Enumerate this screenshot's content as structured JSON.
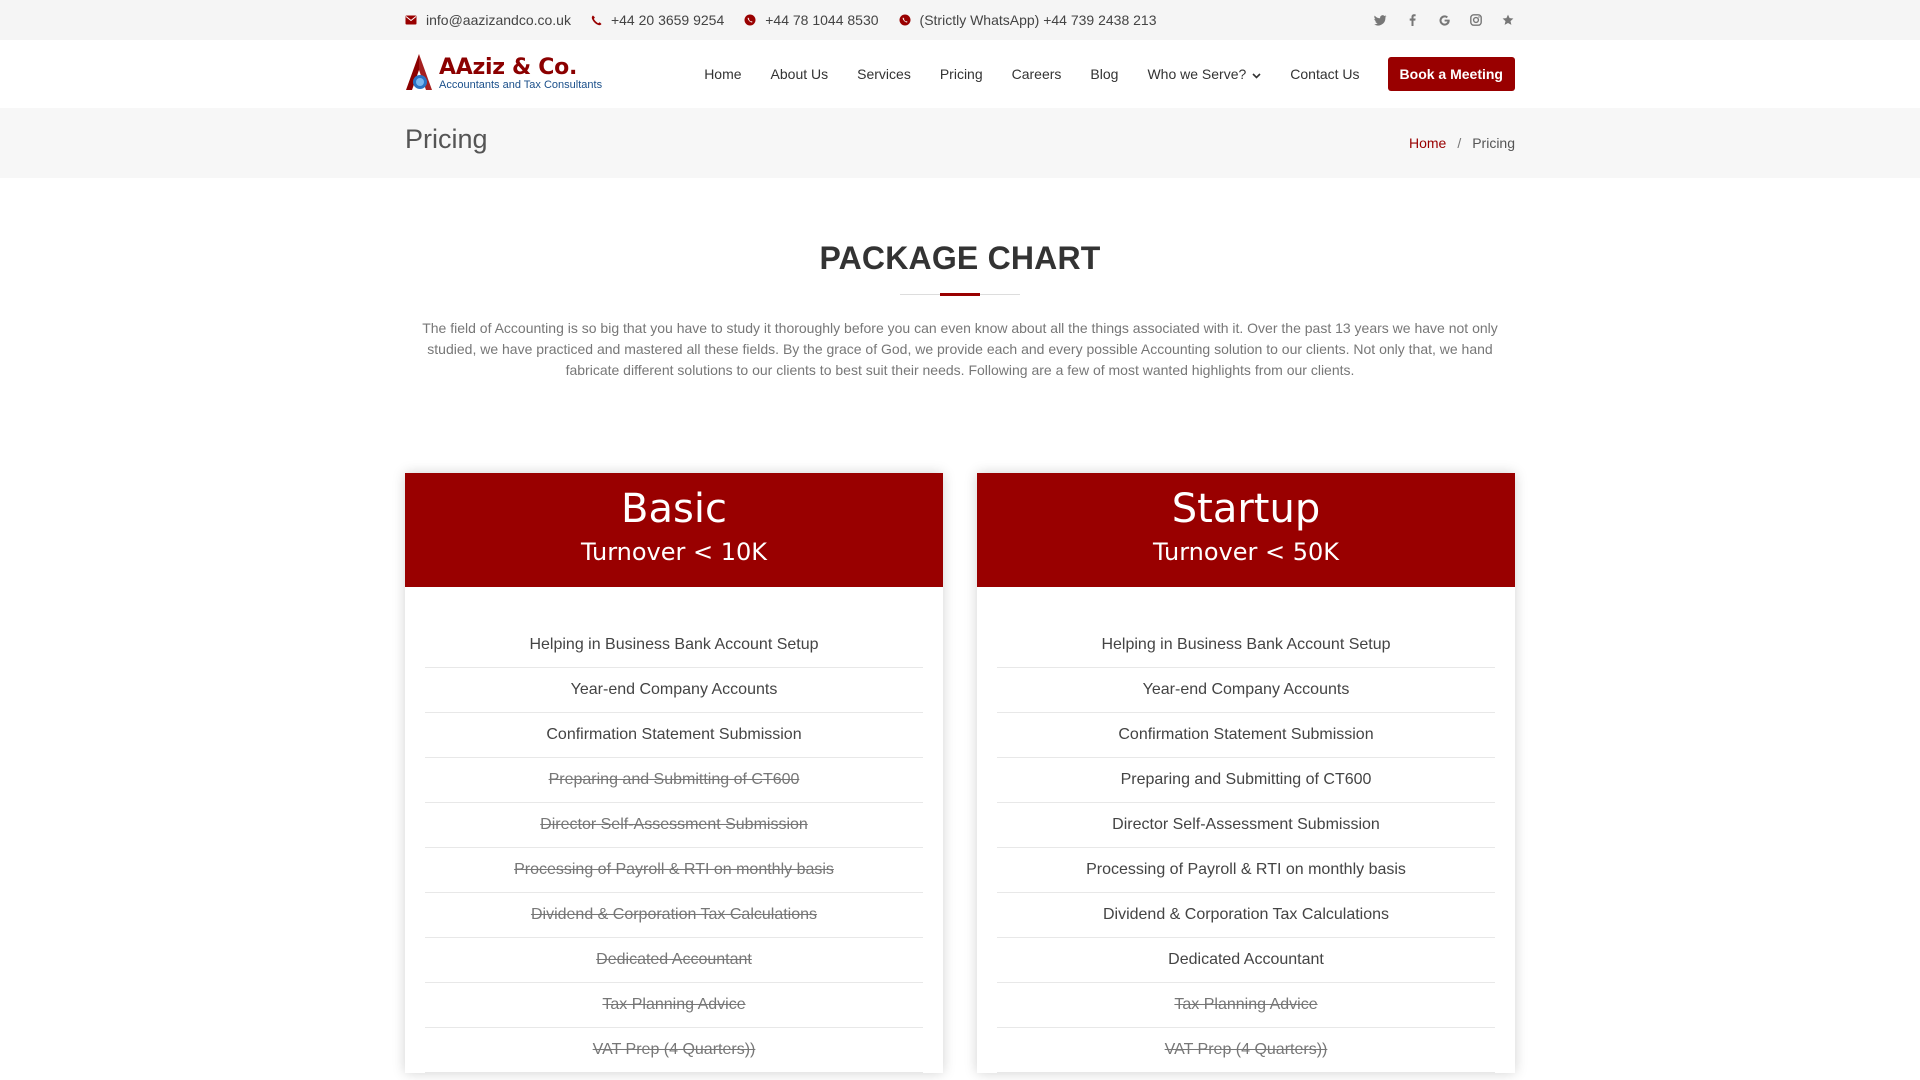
{
  "topbar": {
    "email": "info@aazizandco.co.uk",
    "phone": "+44 20 3659 9254",
    "mobile": "+44 78 1044 8530",
    "whatsapp": "(Strictly WhatsApp) +44 739 2438 213",
    "social_icons": [
      "twitter-icon",
      "facebook-icon",
      "google-icon",
      "instagram-icon",
      "star-icon"
    ]
  },
  "header": {
    "logo_name": "AAziz & Co.",
    "logo_tagline": "Accountants and Tax Consultants",
    "nav": [
      "Home",
      "About Us",
      "Services",
      "Pricing",
      "Careers",
      "Blog",
      "Who we Serve?",
      "Contact Us"
    ],
    "cta": "Book a Meeting"
  },
  "band": {
    "title": "Pricing",
    "breadcrumb_home": "Home",
    "breadcrumb_sep": "/",
    "breadcrumb_current": "Pricing"
  },
  "section": {
    "title": "PACKAGE CHART",
    "intro": "The field of Accounting is so big that you have to study it thoroughly before you can even know about all the things associated with it. Over the past 13 years we have not only studied, we have practiced and mastered all these fields. By the grace of God, we provide each and every possible Accounting solution to our clients. Not only that, we hand fabricate different solutions to our clients to best suit their needs. Following are a few of most wanted highlights from our clients."
  },
  "packages": [
    {
      "name": "Basic",
      "subtitle": "Turnover < 10K",
      "features": [
        {
          "label": "Helping in Business Bank Account Setup",
          "included": true
        },
        {
          "label": "Year-end Company Accounts",
          "included": true
        },
        {
          "label": "Confirmation Statement Submission",
          "included": true
        },
        {
          "label": "Preparing and Submitting of CT600",
          "included": false
        },
        {
          "label": "Director Self-Assessment Submission",
          "included": false
        },
        {
          "label": "Processing of Payroll & RTI on monthly basis",
          "included": false
        },
        {
          "label": "Dividend & Corporation Tax Calculations",
          "included": false
        },
        {
          "label": "Dedicated Accountant",
          "included": false
        },
        {
          "label": "Tax Planning Advice",
          "included": false
        },
        {
          "label": "VAT Prep (4 Quarters))",
          "included": false
        }
      ]
    },
    {
      "name": "Startup",
      "subtitle": "Turnover < 50K",
      "features": [
        {
          "label": "Helping in Business Bank Account Setup",
          "included": true
        },
        {
          "label": "Year-end Company Accounts",
          "included": true
        },
        {
          "label": "Confirmation Statement Submission",
          "included": true
        },
        {
          "label": "Preparing and Submitting of CT600",
          "included": true
        },
        {
          "label": "Director Self-Assessment Submission",
          "included": true
        },
        {
          "label": "Processing of Payroll & RTI on monthly basis",
          "included": true
        },
        {
          "label": "Dividend & Corporation Tax Calculations",
          "included": true
        },
        {
          "label": "Dedicated Accountant",
          "included": true
        },
        {
          "label": "Tax Planning Advice",
          "included": false
        },
        {
          "label": "VAT Prep (4 Quarters))",
          "included": false
        }
      ]
    }
  ],
  "colors": {
    "brand_red": "#990000",
    "band_bg": "#f7f7f7",
    "topbar_bg": "#f5f5f5"
  }
}
